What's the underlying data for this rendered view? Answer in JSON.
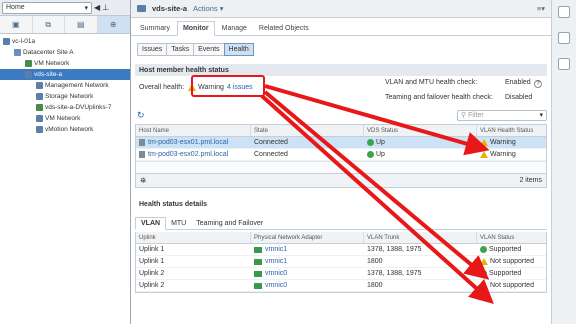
{
  "nav": {
    "home_label": "Home",
    "tree": [
      {
        "label": "vc-l-01a",
        "indent": 0,
        "color": "#5a7fa8"
      },
      {
        "label": "Datacenter Site A",
        "indent": 1,
        "color": "#6a8fb8"
      },
      {
        "label": "VM Network",
        "indent": 2,
        "color": "#4a8a4a"
      },
      {
        "label": "vds-site-a",
        "indent": 2,
        "color": "#5a7fa8",
        "selected": true
      },
      {
        "label": "Management Network",
        "indent": 3,
        "color": "#5a7fa8"
      },
      {
        "label": "Storage Network",
        "indent": 3,
        "color": "#5a7fa8"
      },
      {
        "label": "vds-site-a-DVUplinks-7",
        "indent": 3,
        "color": "#4a8a4a"
      },
      {
        "label": "VM Network",
        "indent": 3,
        "color": "#5a7fa8"
      },
      {
        "label": "vMotion Network",
        "indent": 3,
        "color": "#5a7fa8"
      }
    ]
  },
  "header": {
    "title": "vds-site-a",
    "actions": "Actions ▾"
  },
  "tabs": [
    "Summary",
    "Monitor",
    "Manage",
    "Related Objects"
  ],
  "subtabs": [
    "Issues",
    "Tasks",
    "Events",
    "Health"
  ],
  "host_health": {
    "title": "Host member health status",
    "overall_label": "Overall health:",
    "overall_value": "Warning",
    "issues_link": "4 issues",
    "vlan_mtu_label": "VLAN and MTU health check:",
    "vlan_mtu_value": "Enabled",
    "teaming_label": "Teaming and failover health check:",
    "teaming_value": "Disabled",
    "filter_placeholder": "Filter",
    "columns": [
      "Host Name",
      "State",
      "VDS Status",
      "VLAN Health Status"
    ],
    "rows": [
      {
        "host": "tm-pod03-esx01.pml.local",
        "state": "Connected",
        "vds": "Up",
        "vlan": "Warning"
      },
      {
        "host": "tm-pod03-esx02.pml.local",
        "state": "Connected",
        "vds": "Up",
        "vlan": "Warning"
      }
    ],
    "count": "2 items"
  },
  "details": {
    "title": "Health status details",
    "tabs": [
      "VLAN",
      "MTU",
      "Teaming and Failover"
    ],
    "columns": [
      "Uplink",
      "Physical Network Adapter",
      "VLAN Trunk",
      "VLAN Status"
    ],
    "rows": [
      {
        "uplink": "Uplink 1",
        "nic": "vmnic1",
        "trunk": "1378, 1388, 1975",
        "status": "Supported",
        "ok": true
      },
      {
        "uplink": "Uplink 1",
        "nic": "vmnic1",
        "trunk": "1800",
        "status": "Not supported",
        "ok": false
      },
      {
        "uplink": "Uplink 2",
        "nic": "vmnic0",
        "trunk": "1378, 1388, 1975",
        "status": "Supported",
        "ok": true
      },
      {
        "uplink": "Uplink 2",
        "nic": "vmnic0",
        "trunk": "1800",
        "status": "Not supported",
        "ok": false
      }
    ]
  },
  "colors": {
    "accent": "#3b7bbf",
    "annotation": "#e81818",
    "warning": "#e9b100",
    "ok": "#3aa54b"
  }
}
